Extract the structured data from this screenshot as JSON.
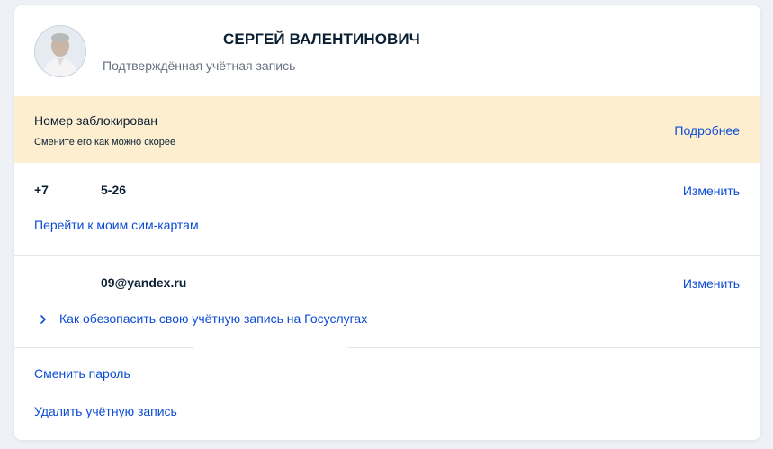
{
  "profile": {
    "name": "СЕРГЕЙ ВАЛЕНТИНОВИЧ",
    "status": "Подтверждённая учётная запись"
  },
  "alert": {
    "title": "Номер заблокирован",
    "subtitle": "Смените его как можно скорее",
    "link": "Подробнее",
    "background": "#fdeed0"
  },
  "phone": {
    "prefix": "+7",
    "suffix": "5-26",
    "change_link": "Изменить",
    "sim_link": "Перейти к моим сим-картам"
  },
  "email": {
    "value": "09@yandex.ru",
    "change_link": "Изменить",
    "secure_link": "Как обезопасить свою учётную запись на Госуслугах"
  },
  "actions": {
    "change_password": "Сменить пароль",
    "delete_account": "Удалить учётную запись"
  },
  "colors": {
    "link": "#0d4cd3",
    "text": "#0b1f33",
    "muted": "#66727f",
    "page_bg": "#eef1f6"
  },
  "icons": {
    "avatar": "user-photo",
    "chevron": "chevron-right-icon"
  }
}
